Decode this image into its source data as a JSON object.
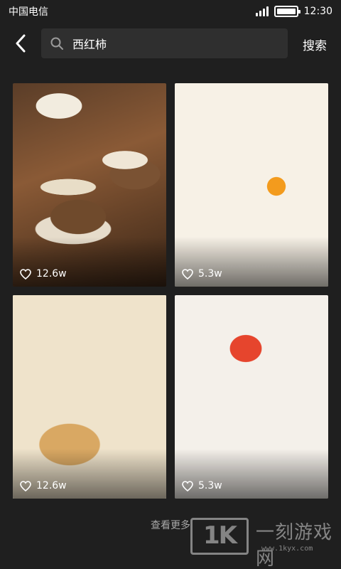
{
  "status_bar": {
    "carrier": "中国电信",
    "time": "12:30",
    "battery_level": 1.0
  },
  "search": {
    "query": "西红柿",
    "search_button_label": "搜索",
    "icons": {
      "back": "chevron-left-icon",
      "search": "search-icon"
    }
  },
  "results": [
    {
      "likes": "12.6w",
      "image": "food-photo-burgers"
    },
    {
      "likes": "5.3w",
      "image": "food-photo-noodles-fried-egg"
    },
    {
      "likes": "12.6w",
      "image": "food-photo-scallion-cakes"
    },
    {
      "likes": "5.3w",
      "image": "food-photo-omelette-rice"
    }
  ],
  "load_more_label": "查看更多",
  "watermark": {
    "logo_text": "1K",
    "name": "一刻游戏网",
    "url": "www.1kyx.com"
  },
  "colors": {
    "background": "#1f1f1f",
    "search_box": "#2f2f2f",
    "text": "#ffffff",
    "muted_text": "#a8a8a8"
  }
}
